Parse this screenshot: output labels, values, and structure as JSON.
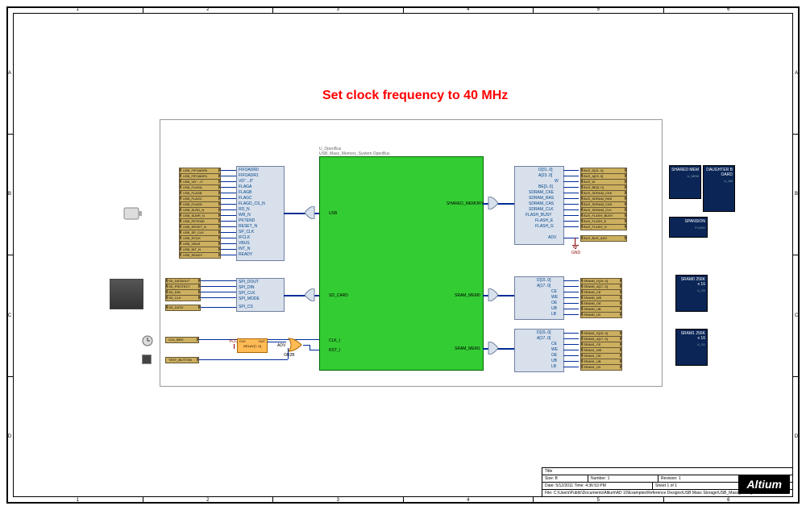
{
  "ruler_cols": [
    "1",
    "2",
    "3",
    "4",
    "5",
    "6"
  ],
  "ruler_rows": [
    "A",
    "B",
    "C",
    "D"
  ],
  "annotation": "Set clock frequency to 40 MHz",
  "openbus": {
    "ref": "U_OpenBus",
    "name": "USB_Mass_Memory_System.OpenBus",
    "left_ports": [
      "USB",
      "SD_CARD",
      "CLK_I",
      "RST_I"
    ],
    "right_ports": [
      "SHARED_MEMORY",
      "SRAM_MEM0",
      "SRAM_MEM1"
    ]
  },
  "left_pin_banks": {
    "usb": [
      "FIFOADR0",
      "FIFOADR1",
      "VD\"…0\"",
      "FLAGA",
      "FLAGB",
      "FLAGC",
      "FLAGD_CS_N",
      "RD_N",
      "WR_N",
      "PKTEND",
      "RESET_N",
      "SP_CLK",
      "IFCLK",
      "VBUS",
      "INT_N",
      "READY"
    ],
    "sd": [
      "SPI_DOUT",
      "SPI_DIN",
      "SPI_CLK",
      "SPI_MODE",
      "SPI_CS"
    ]
  },
  "left_busports": {
    "usb": [
      "USB_FIFOADR0",
      "USB_FIFOADR1",
      "USB_VD\"…0\"",
      "USB_FLAGA",
      "USB_FLAGB",
      "USB_FLAGC",
      "USB_FLAGD",
      "USB_SLRD_N",
      "USB_SLWR_N",
      "USB_PKTEND",
      "USB_RESET_N",
      "USB_SP_CLK",
      "USB_IFCLK",
      "USB_VBUS",
      "USB_INT_N",
      "USB_READY"
    ],
    "sd": [
      "SD_DATAOUT",
      "SD_PROTECT",
      "SD_DIN",
      "SD_CLK",
      "SD_DATD"
    ],
    "clk": "CLK_BRD",
    "test": "TEST_BUTTON"
  },
  "right_pin_banks": {
    "shared": [
      "D[31..0]",
      "A[23..0]",
      "W",
      "BE[3..0]",
      "SDRAM_CKE",
      "SDRAM_RAS",
      "SDRAM_CAS",
      "SDRAM_CLK",
      "FLASH_BUSY",
      "FLASH_E",
      "FLASH_G",
      "ADV"
    ],
    "sram0": [
      "D[15..0]",
      "A[17..0]",
      "CE",
      "WE",
      "OE",
      "UB",
      "LB"
    ],
    "sram1": [
      "D[15..0]",
      "A[17..0]",
      "CE",
      "WE",
      "OE",
      "UB",
      "LB"
    ]
  },
  "right_busports": {
    "shared": [
      "BUS_D[31..0]",
      "BUS_A[23..0]",
      "BUS_W",
      "BUS_BE[3..0]",
      "BUS_SDRAM_CKE",
      "BUS_SDRAM_RAS",
      "BUS_SDRAM_CAS",
      "BUS_SDRAM_CLK",
      "BUS_FLASH_BUSY",
      "BUS_FLASH_E",
      "BUS_FLASH_G",
      "BUS_BUS_ADV"
    ],
    "sram0": [
      "SRAM0_D[15..0]",
      "SRAM0_A[17..0]",
      "SRAM0_CE",
      "SRAM0_WE",
      "SRAM0_OE",
      "SRAM0_UB",
      "SRAM0_LB"
    ],
    "sram1": [
      "SRAM1_D[15..0]",
      "SRAM1_A[17..0]",
      "SRAM1_CE",
      "SRAM1_WE",
      "SRAM1_OE",
      "SRAM1_UB",
      "SRAM1_LB"
    ]
  },
  "subsheets": [
    {
      "t": "SHARED MEM",
      "g": "U_MEM"
    },
    {
      "t": "DAUGHTER BOARD",
      "g": "U_DB"
    },
    {
      "t": "SPANSION",
      "g": "FLASH"
    },
    {
      "t": "SRAM0 256K x 16",
      "g": "U_S0"
    },
    {
      "t": "SRAM1 256K x 16",
      "g": "U_S1"
    }
  ],
  "delay": {
    "label": "DELAY[7..0]",
    "in": "CLK",
    "out": "OUT",
    "adv": "ADV",
    "tag": "OR2B"
  },
  "gnd_label": "GND",
  "title_block": {
    "title": "Title",
    "size": "Size:",
    "size_v": "B",
    "number": "Number:",
    "number_v": "1",
    "revision": "Revision:",
    "revision_v": "1",
    "date": "Date:",
    "date_v": "5/12/2011",
    "time": " Time:",
    "time_v": "4:36:53 PM",
    "sheet": "Sheet",
    "sheet_v": "1",
    "of": "of",
    "of_v": "1",
    "file": "File:",
    "file_v": "C:\\Users\\Public\\Documents\\Altium\\AD 10\\Examples\\Reference Designs\\USB Mass Storage\\USB_Mass_Storage.SchDoc"
  },
  "logo": "Altium"
}
